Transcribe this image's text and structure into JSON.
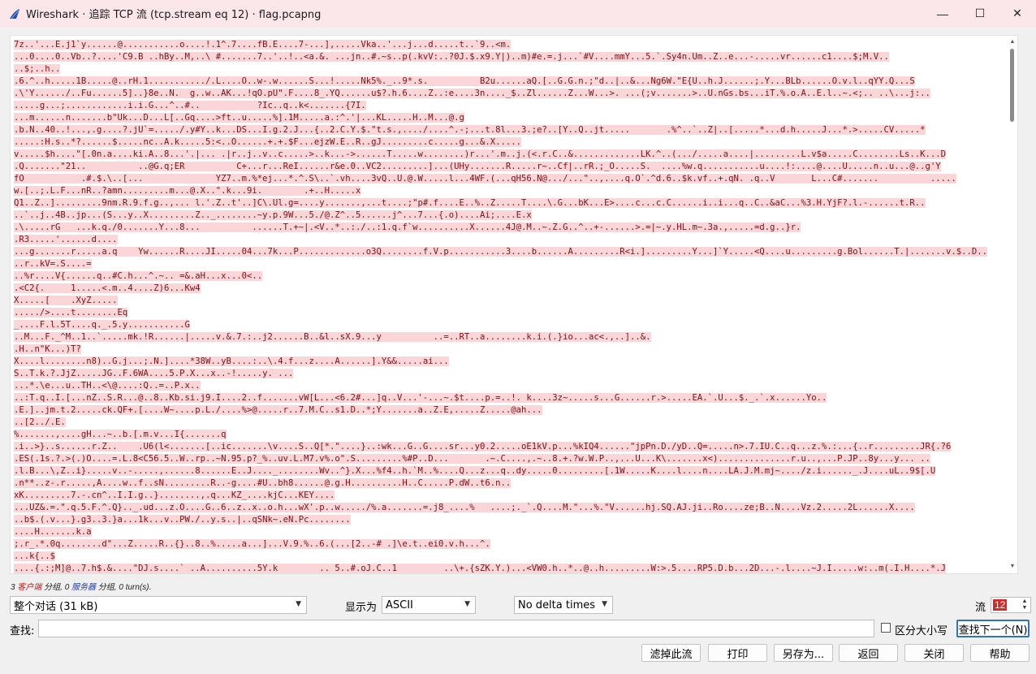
{
  "window": {
    "title": "Wireshark · 追踪 TCP 流 (tcp.stream eq 12) · flag.pcapng",
    "minimize": "—",
    "maximize": "☐",
    "close": "✕"
  },
  "stream_lines": [
    "7z..'...E.j1`y......@...........o....!.1^.7....fB.E....7-...],.....Vka..'...j...d.....t..`9..<m.",
    "...0....0..Vb..?....'C9.B ..hBy..M,..\\ #.......7..'..!..<a.&. ...jn..#.~s..p(.kvV:..?0J.$.x9.Y|)..m)#e.=.j...`#V....mmY...5.`.Sy4n.Um..Z..e...-.....vr......c1....$;M.V..",
    "..$;..h..",
    ".6.^..h.....1B.....@..rH.1.........../.L....O..w-.w......S...!.....Nk5%._..9*.s.          B2u......aQ.[..G.G.n.;\"d..|..&...Ng6W.\"E{U..h.J......;.Y...BLb......O.v.l..qYY.Q...S",
    ".\\'Y....../..Fu......5]..}8e..N.  g..w..AK...!qO.pU\".F....8_.YQ......u$?.h.6....Z..:e....3n...._$..Zl......Z...W...>. ...(;v.......>..U.nGs.bs...iT.%.o.A..E.l..~.<;.. ..\\...j:..",
    ".....g...;............i.i.G...^..#..           ?Ic..q..k<.......{7I.",
    "...m......n.......b\"Uk...D...L[..Gq....>ft..u.....%].1M.....a.:^.'|...KL.....H..M...@.g",
    ".b.N..40..!...,.g....?.jU`=...../.y#Y..k...DS...I.g.2.J...{..2.C.Y.$.\"t.s.,..../....^.-;...t.8l...3.;e?..[Y..Q..jt.....       .%^..`..Z|..[.....*...d.h.....J...*.>.....CV.....*",
    ".....:H.s..*?......$.....nc..A.k.....5:<..O......+.+.$F...ejzW.E..R..gJ.........c.....g...&.X.....",
    "v.....$h....\"[.0n.a....ki.A..8...'.|... .|r..j..v..c.....>..k...->......T.....w........)r...'.m..j.(<.r.C..&.............LK.^..(.../.....a....|.........L.v$a.....C........Ls..K...D",
    ".Q.......\"21..          ..@G.q;ER          C+...r...ReI......r&e.0..VC2.........]...(UHy.......R.....r~..Cf|..rR.;_O.....S.  ....%w.q...........u....!:....@....U.....n..u...@..g'Y",
    "fO           .#.$.\\..[...              YZ7..m.%*ej...*.^.S\\..`.vh....3vQ..U.@.W.....l...4WF.(...qH56.N@.../...\"..,....q.O`.^d.6..$k.vf..+.qN. .q..V       L...C#.......          .....",
    "w.[..;.L.F...nR..?amn.........m...@.X..\".k...9i.        .+..H.....x",
    "Q1..Z..].........9nm.R.9.f.g..,... l.'.Z..t'..]C\\.Ul.g=....y.......,...t....;\"p#.f....E..%..Z.....T....\\.G...bK...E>....c...c.C......i..i...q..C..&aC...%3.H.YjF?.l.-......t.R..",
    "..`..j..4B..jp...(S...y..X.........Z.._........~y.p.9W...5./@.Z^..5......j^...7...{.o)....Ai;....E.x",
    ".\\.....rG   ...k.q./0.......Y...8...          ......T.+~|.<V..*..:./..:1.q.f`w..........X......4J@.M..~.Z.G..^..+-......>.=|~.y.HL.m~.3a.,.....=d.g..}r.",
    ".R3.....'......d....",
    "...g.......r.....a.q    Yw......R....JI.....04...7k...P.............o3Q........f.V.p...........3....b......A.........R<i.].........Y...]`Y.....<Q....u.........g.Bol......T.|.......v.$..D..",
    "..r..kV=.S....=",
    "..%r....V{......q..#C.h...^.~.. =&.aH...x...0<..",
    ".<C2{.     1.....<.m..4....Z)6...Kw4",
    "X.....[    .XyZ.....",
    "...../>....t........Eq",
    "_....F.l.5T....q._.5.y...........G",
    "..M...F._^M..1..`.....mk.!R......|.....v.&.7.:..j2......B..&l..sX.9...y          ..=..RT..a........k.i.(.}io...ac<.,..]..&.",
    ".H..n\"K...)T?",
    "X....l........n8)..G.j...;.N.]....*38W..yB....:..\\.4.f...z....A......].Y&&.....ai...",
    "S..T.k.?.JjZ.....JG..F.6WA....5.P.X...x..-!.....y. ...",
    "...*.\\e...u..TH..<\\@....:Q..=..P.x..",
    "..:T.q..I.[...nZ..S.R...@..8..Kb.si.j9.I....2..f.......vW[L...<6.2#...]q..V...'-...~.$t....p.=..!. k....3z~.....s...G......r.>.....EA.`.U...$._.`.x......Yo..",
    ".E.]..jm.t.2.....ck.QF+.[....W~....p.L./....%>@.....r..7.M.C..s1.D..*;Y.......a..Z.E,.....Z.....@ah...",
    "..[2../.E.",
    "%.......,....gH...~..b.[.m.v...I{.......q",
    ".i..>}..s......r.Z..    .U6(l<.......[..ic.......\\v....S..Q[*.\"....}..:wk...G..G....sr...y0.2.....oE1kV.p...%kIQ4......\"jpPn.D./yD..Q=.....n>.7.IU.C..q...z.%.:...{..r.........JR{.?6",
    ".ES(.1s.?.>(.)O....=.L.8<C56.5..W..rp..~N.95.p?_%..uv.L.M7.v%.o\".S.........%#P..D...       .~.C....,.~..8.+.?w.W.P..,...U...K\\.......x<)..............r.u..,...P.JP..8y...y... ..",
    ".l.B...\\,Z..i}.....v..-.....,......8......E..J...._........Wv..^}.X...%f4..h.`M..%....Q...z...q..dy.....0.........[.1W.....K....l....n....LA.J.M.mj~..../z.i......_.J....uL..9$[.U",
    ".n**..z-.r.....,A....w..f..sN.........R..-g....#U..bh8......@.g.H..........H..C.....P.dW..t6.n..",
    "xK.........7.-.cn^..I.I.g..}........,.q...KZ_....kjC...KEY....",
    "...UZ&.=.\".q.5.F.^.Q}.._.ud...z.O....G..6..z..x..o.h...wX'.p..w...../%.a.......=.j8_....%   ....;._`.Q....M.\"...%.\"V......hj.SQ.AJ.ji..Ro....ze;B..N....Vz.2.....2L......X....",
    "..b$.(.v...}.g3..3.}a...1k...v..PW./..y.s..|..qSNk~.eN.Pc........",
    "....H.......k.a",
    ";.r_.*.0q........d\"...Z.....R..{}..8..%.....a...]...V.9.%..6.(...[2..-# .]\\e.t..ei0.v.h...^.",
    "...k{..$",
    "....{.:;M]@..7.h$.&....\"DJ.s....` ..A..........5Y.k        .. 5..#.oJ.C..1         ..\\+.{sZK.Y.)...<VW0.h..*..@..h.........W:>.5....RP5.D.b...2D...-.l....~J.I.....w:..m(.I.H....*.J"
  ],
  "status": {
    "count_a": "3",
    "client_label": "客户端",
    "text_a": " 分组, ",
    "count_b": "0",
    "server_label": "服务器",
    "text_b": " 分组, ",
    "count_c": "0",
    "text_c": " turn(s)."
  },
  "controls": {
    "conversation_select": "整个对话 (31 kB)",
    "show_as_label": "显示为",
    "show_as_select": "ASCII",
    "delta_select": "No delta times",
    "stream_label": "流",
    "stream_value": "12"
  },
  "find": {
    "label": "查找:",
    "value": "",
    "case_sensitive_label": "区分大小写",
    "find_next_button": "查找下一个(N)"
  },
  "buttons": {
    "filter_out": "滤掉此流",
    "print": "打印",
    "save_as": "另存为...",
    "back": "返回",
    "close": "关闭",
    "help": "帮助"
  },
  "icons": {
    "app": "wireshark-fin-icon",
    "caret": "chevron-down-icon"
  },
  "colors": {
    "client_bg": "#fbd6d9",
    "client_fg": "#7a1217",
    "titlebar": "#fbe6e9",
    "accent": "#3373b8"
  }
}
